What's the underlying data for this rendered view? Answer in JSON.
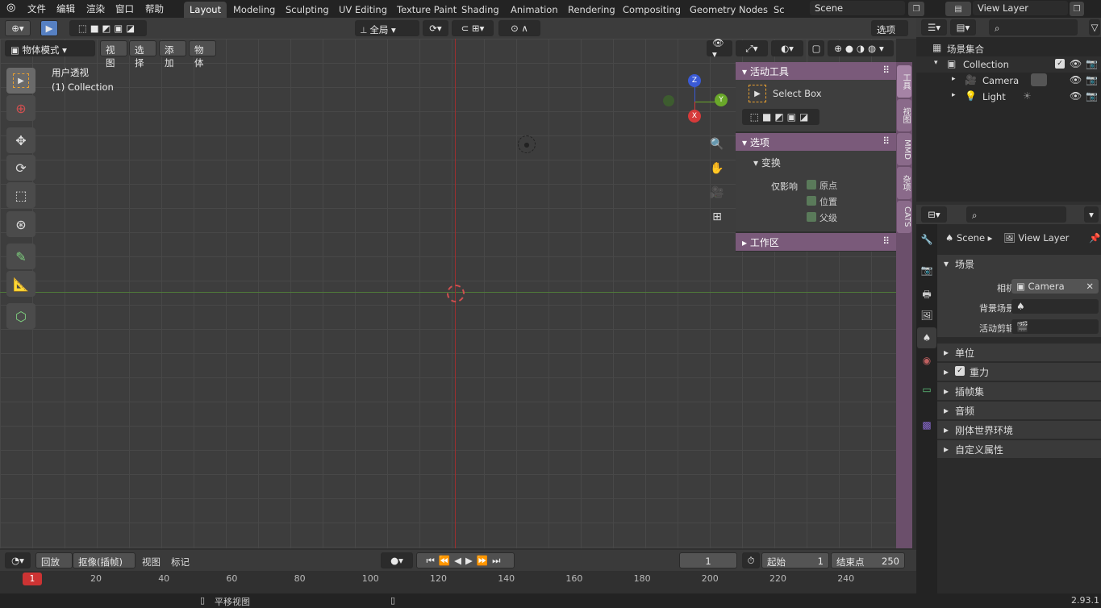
{
  "menu": {
    "file": "文件",
    "edit": "编辑",
    "render": "渲染",
    "window": "窗口",
    "help": "帮助"
  },
  "workspaces": [
    "Layout",
    "Modeling",
    "Sculpting",
    "UV Editing",
    "Texture Paint",
    "Shading",
    "Animation",
    "Rendering",
    "Compositing",
    "Geometry Nodes",
    "Sc"
  ],
  "scene_field": "Scene",
  "view_layer_field": "View Layer",
  "header": {
    "transform_orientation": "全局",
    "options": "选项",
    "mode": "物体模式",
    "view": "视图",
    "select": "选择",
    "add": "添加",
    "object": "物体"
  },
  "viewport": {
    "view_name": "用户透视",
    "collection_label": "(1) Collection",
    "axis_x": "X",
    "axis_y": "Y",
    "axis_z": "Z"
  },
  "npanel": {
    "active_tool_title": "活动工具",
    "tool_name": "Select Box",
    "options_title": "选项",
    "transform_title": "变换",
    "affect_only_label": "仅影响",
    "origin_label": "原点",
    "location_label": "位置",
    "parent_label": "父级",
    "workspace_title": "工作区",
    "tabs": [
      "工具",
      "视图",
      "MMD",
      "杂项",
      "CATS"
    ]
  },
  "outliner": {
    "scene_collection": "场景集合",
    "collection": "Collection",
    "camera": "Camera",
    "light": "Light"
  },
  "properties": {
    "breadcrumb_scene": "Scene",
    "breadcrumb_view_layer": "View Layer",
    "scene_panel": "场景",
    "camera_label": "相机",
    "camera_value": "Camera",
    "background_label": "背景场景",
    "active_clip_label": "活动剪辑",
    "units": "单位",
    "gravity": "重力",
    "keying_sets": "插帧集",
    "audio": "音频",
    "rigid_body": "刚体世界环境",
    "custom_props": "自定义属性"
  },
  "timeline": {
    "playback": "回放",
    "keying": "抠像(插帧)",
    "view": "视图",
    "marker": "标记",
    "current_frame": "1",
    "start_label": "起始",
    "start_value": "1",
    "end_label": "结束点",
    "end_value": "250",
    "ticks": [
      "20",
      "40",
      "60",
      "80",
      "100",
      "120",
      "140",
      "160",
      "180",
      "200",
      "220",
      "240"
    ],
    "playhead": "1"
  },
  "status": {
    "pan_view": "平移视图",
    "version": "2.93.1"
  },
  "colors": {
    "accent": "#5680c2",
    "npanel_header": "#7a5a7a",
    "axis_x": "#d63a3a",
    "axis_y": "#6aa82a",
    "axis_z": "#3a5ad6"
  }
}
